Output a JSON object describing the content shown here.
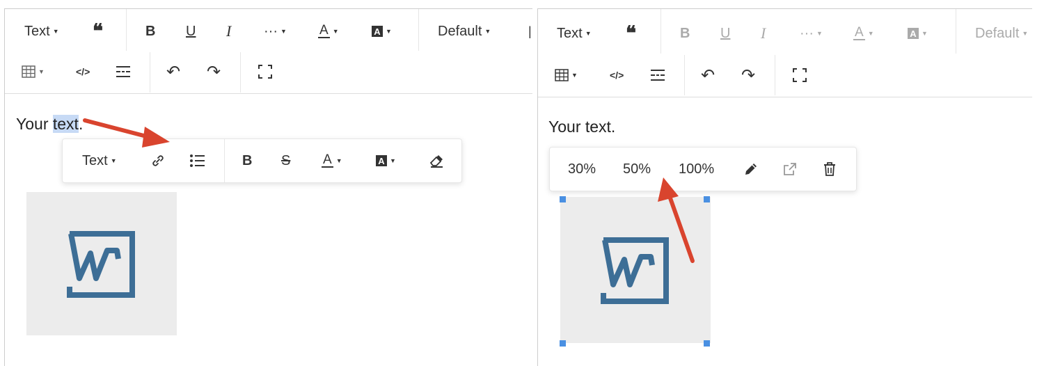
{
  "left": {
    "toolbar": {
      "heading_label": "Text",
      "font_family_label": "Default",
      "more_label": "···"
    },
    "content_text_before": "Your ",
    "content_text_selected": "text",
    "content_text_after": ".",
    "inline_toolbar": {
      "heading_label": "Text"
    }
  },
  "right": {
    "toolbar": {
      "heading_label": "Text",
      "font_family_label": "Default",
      "more_label": "···"
    },
    "content_text": "Your text.",
    "image_toolbar": {
      "size_options": [
        "30%",
        "50%",
        "100%"
      ]
    }
  },
  "colors": {
    "accent": "#d9442e",
    "selection": "#c7daf5",
    "logo": "#3d6e96",
    "handle": "#4a90e2"
  }
}
